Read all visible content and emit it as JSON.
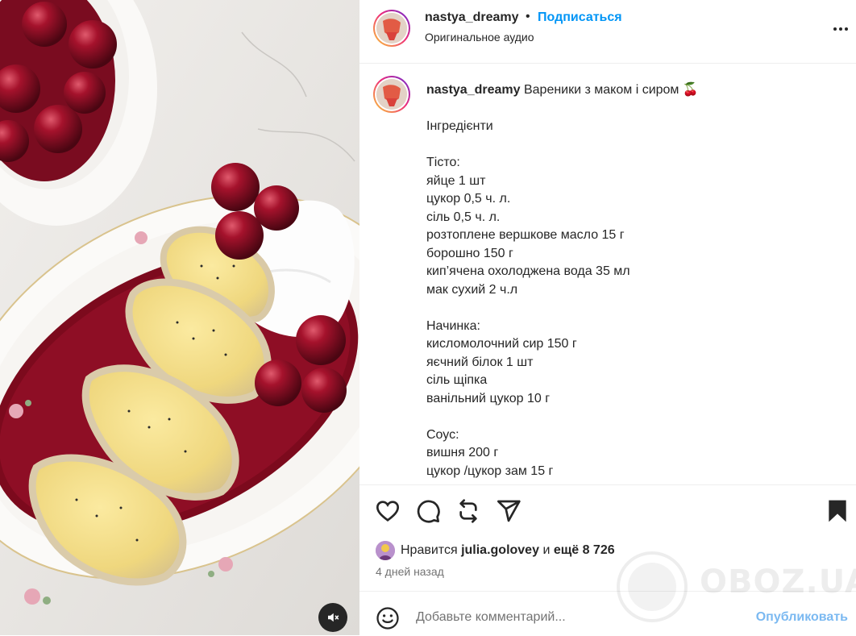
{
  "header": {
    "username": "nastya_dreamy",
    "separator": "•",
    "follow_label": "Подписаться",
    "audio_label": "Оригинальное аудио"
  },
  "caption": {
    "username": "nastya_dreamy",
    "title": "Вареники з маком і сиром 🍒",
    "lines": [
      "Інгредієнти",
      "",
      "Тісто:",
      "яйце 1 шт",
      "цукор 0,5 ч. л.",
      "сіль 0,5 ч. л.",
      "розтоплене вершкове масло 15 г",
      "борошно 150 г",
      "кип’ячена охолоджена вода 35 мл",
      "мак сухий 2 ч.л",
      "",
      "Начинка:",
      "кисломолочний сир 150 г",
      "яєчний білок 1 шт",
      "сіль щіпка",
      "ванільний цукор 10 г",
      "",
      "Соус:",
      "вишня 200 г",
      "цукор /цукор зам 15 г"
    ]
  },
  "likes": {
    "prefix": "Нравится",
    "user": "julia.golovey",
    "and": "и",
    "more": "ещё 8 726"
  },
  "timestamp": "4 дней назад",
  "comment": {
    "placeholder": "Добавьте комментарий...",
    "publish_label": "Опубликовать"
  },
  "watermark": "OBOZ.UA",
  "icons": [
    "heart-icon",
    "comment-icon",
    "repost-icon",
    "share-icon",
    "bookmark-icon",
    "emoji-icon",
    "more-icon",
    "mute-icon"
  ],
  "colors": {
    "accent": "#0095f6",
    "publish_disabled": "#7bb9f1",
    "text": "#262626",
    "muted": "#737373"
  }
}
